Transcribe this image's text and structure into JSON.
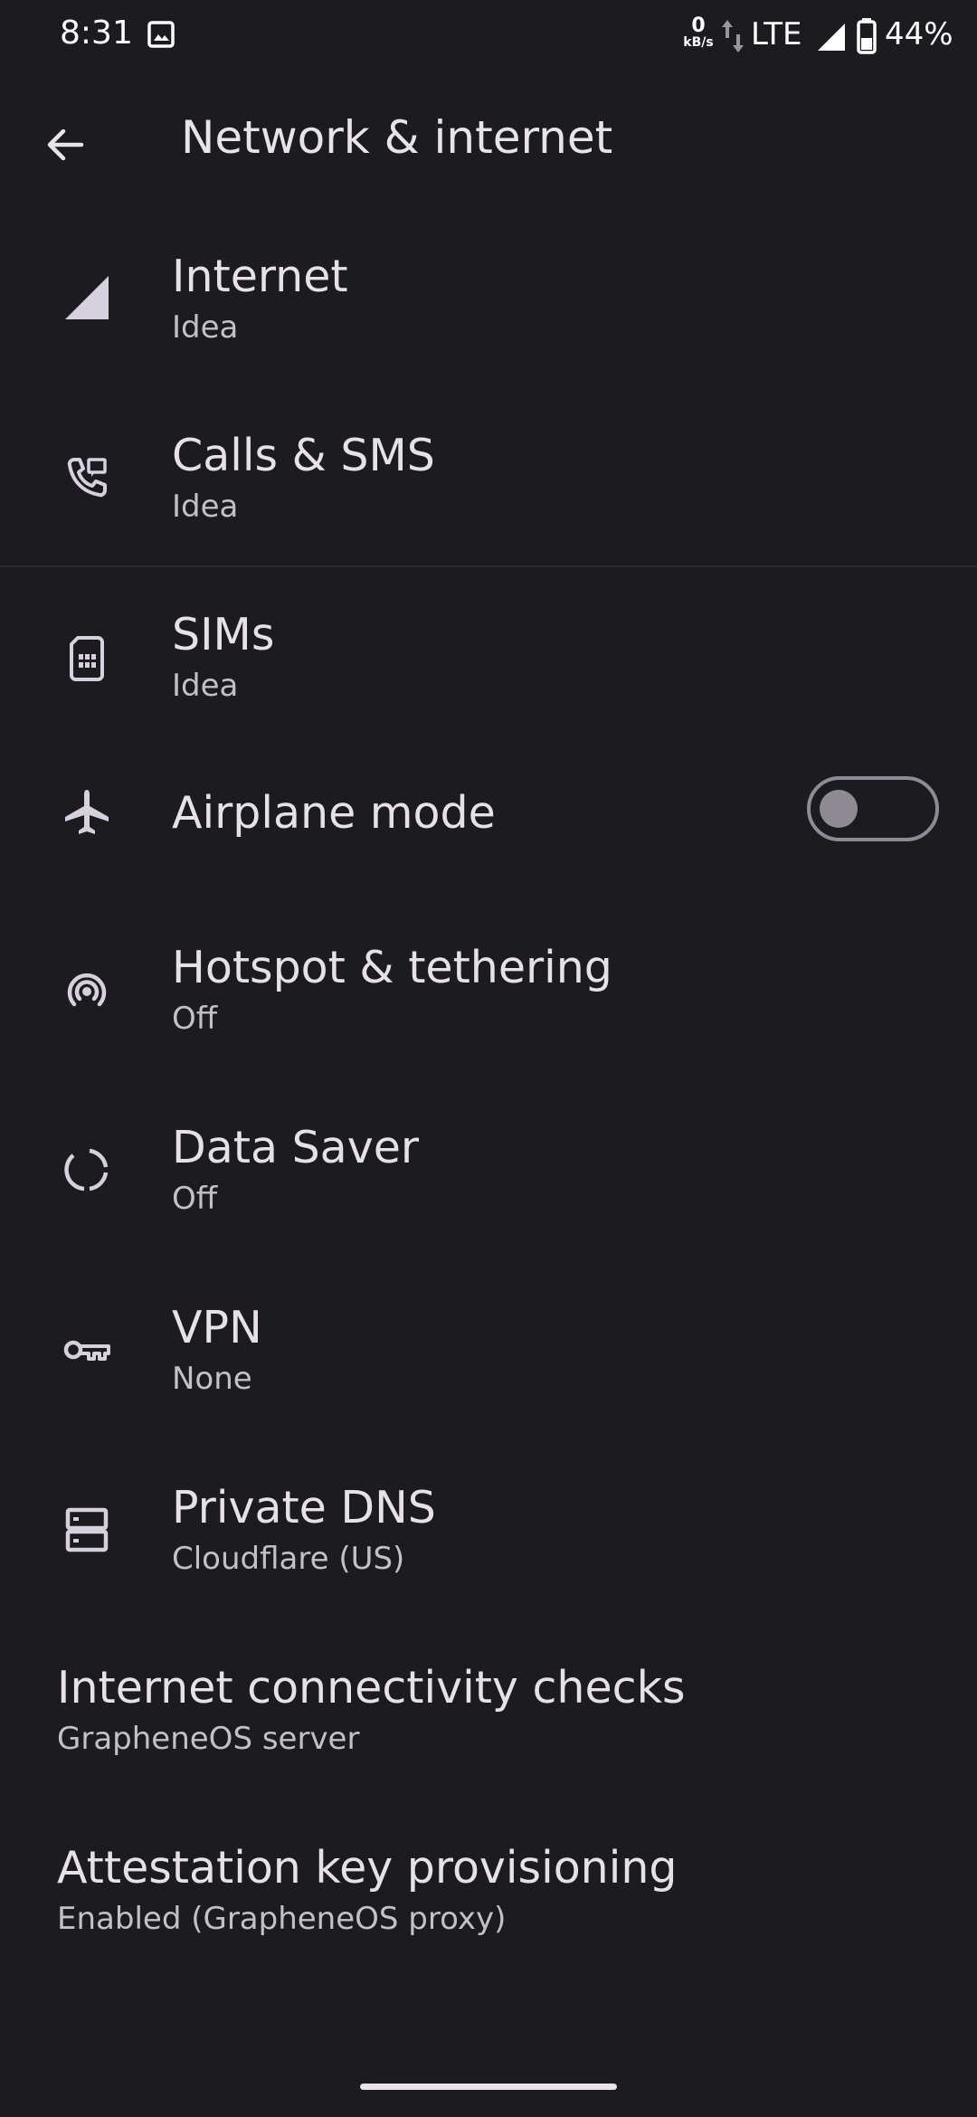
{
  "status_bar": {
    "time": "8:31",
    "net_speed_value": "0",
    "net_speed_unit": "kB/s",
    "network_type": "LTE",
    "battery": "44%"
  },
  "app_bar": {
    "title": "Network & internet"
  },
  "items": [
    {
      "title": "Internet",
      "summary": "Idea",
      "icon": "signal-icon"
    },
    {
      "title": "Calls & SMS",
      "summary": "Idea",
      "icon": "phone-icon"
    },
    {
      "title": "SIMs",
      "summary": "Idea",
      "icon": "sim-card-icon"
    },
    {
      "title": "Airplane mode",
      "icon": "airplane-icon",
      "toggle": "off"
    },
    {
      "title": "Hotspot & tethering",
      "summary": "Off",
      "icon": "hotspot-icon"
    },
    {
      "title": "Data Saver",
      "summary": "Off",
      "icon": "data-saver-icon"
    },
    {
      "title": "VPN",
      "summary": "None",
      "icon": "vpn-key-icon"
    },
    {
      "title": "Private DNS",
      "summary": "Cloudflare (US)",
      "icon": "dns-icon"
    },
    {
      "title": "Internet connectivity checks",
      "summary": "GrapheneOS server"
    },
    {
      "title": "Attestation key provisioning",
      "summary": "Enabled (GrapheneOS proxy)"
    }
  ],
  "colors": {
    "background": "#1c1b20",
    "text_primary": "#e6e1e8",
    "text_secondary": "#c4c0c8",
    "icon": "#d6d1dc",
    "toggle_off": "#8f8b94"
  }
}
